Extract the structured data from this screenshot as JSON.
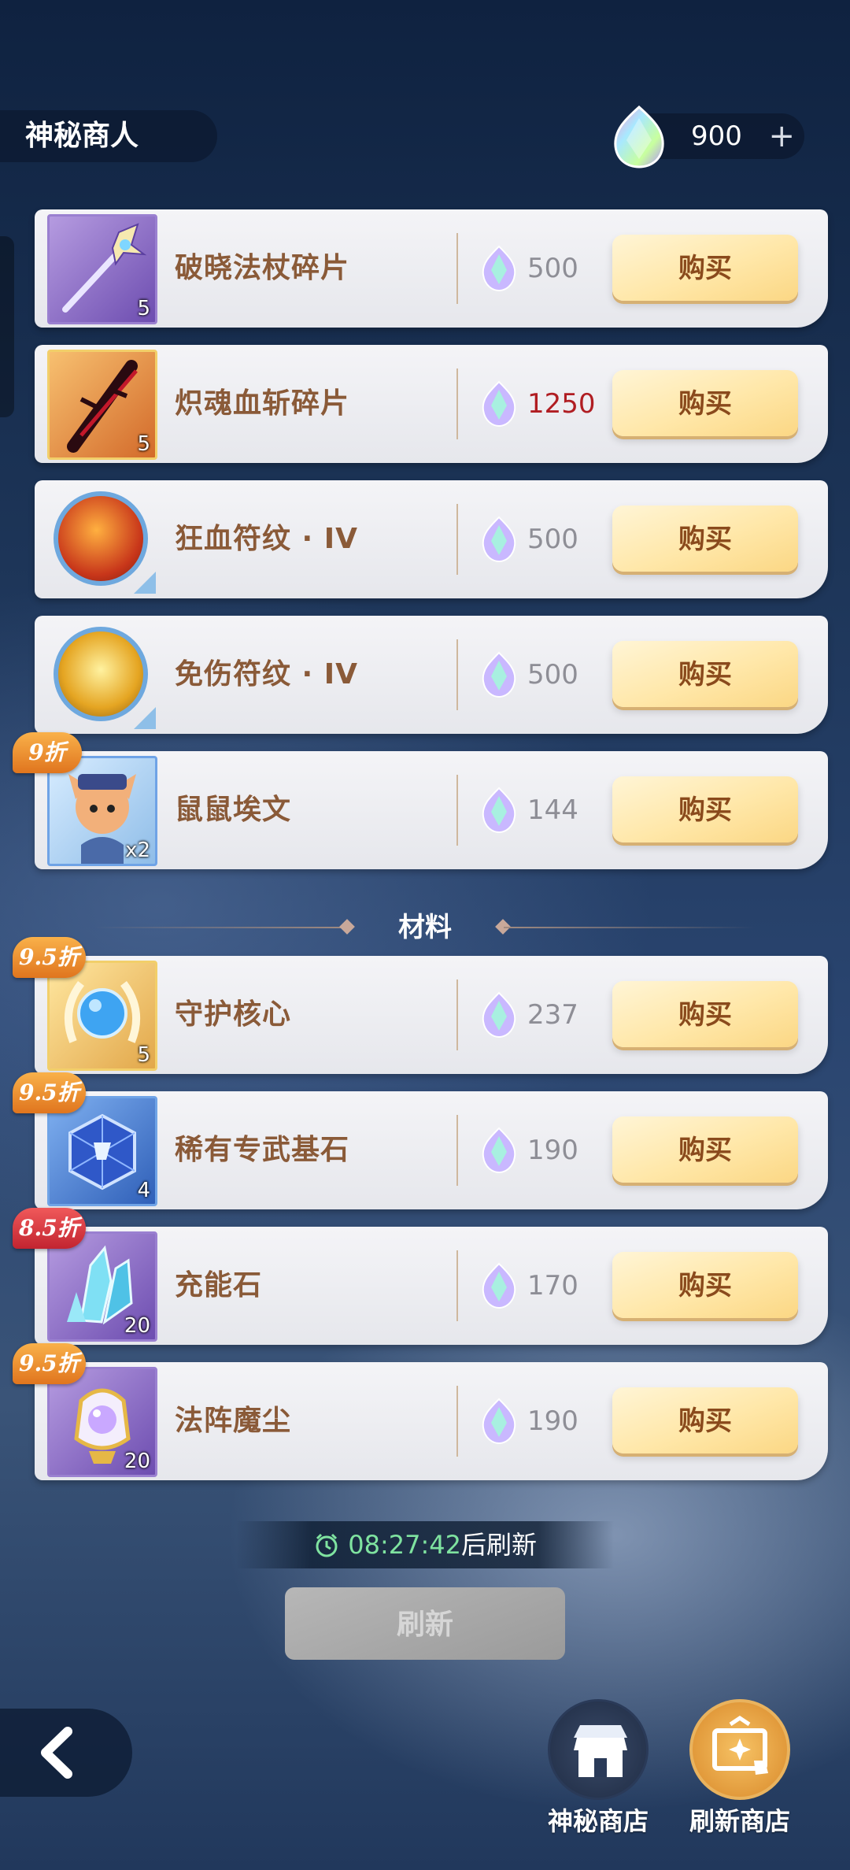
{
  "header": {
    "title": "神秘商人",
    "currency_amount": "900",
    "plus": "+"
  },
  "section_title": "材料",
  "items": [
    {
      "name": "破晓法杖碎片",
      "count": "5",
      "price": "500",
      "buy": "购买",
      "icon": "staff-fragment-icon"
    },
    {
      "name": "炽魂血斩碎片",
      "count": "5",
      "price": "1250",
      "buy": "购买",
      "icon": "blade-fragment-icon"
    },
    {
      "name": "狂血符纹 · IV",
      "price": "500",
      "buy": "购买",
      "icon": "fire-rune-icon"
    },
    {
      "name": "免伤符纹 · IV",
      "price": "500",
      "buy": "购买",
      "icon": "gold-rune-icon"
    },
    {
      "name": "鼠鼠埃文",
      "count": "x2",
      "price": "144",
      "buy": "购买",
      "badge": "9折",
      "icon": "hero-card-icon"
    },
    {
      "name": "守护核心",
      "count": "5",
      "price": "237",
      "buy": "购买",
      "badge": "9.5折",
      "icon": "guardian-core-icon"
    },
    {
      "name": "稀有专武基石",
      "count": "4",
      "price": "190",
      "buy": "购买",
      "badge": "9.5折",
      "icon": "cube-stone-icon"
    },
    {
      "name": "充能石",
      "count": "20",
      "price": "170",
      "buy": "购买",
      "badge": "8.5折",
      "icon": "crystal-icon"
    },
    {
      "name": "法阵魔尘",
      "count": "20",
      "price": "190",
      "buy": "购买",
      "badge": "9.5折",
      "icon": "magic-dust-jar-icon"
    }
  ],
  "timer": {
    "time": "08:27:42",
    "suffix": "后刷新"
  },
  "refresh_button": "刷新",
  "nav": {
    "shop_label": "神秘商店",
    "refresh_shop_label": "刷新商店"
  },
  "colors": {
    "price_expensive": "#b01d22",
    "buy_button": "#ffe7a8",
    "badge_orange": "#e0751e",
    "badge_red": "#c22430"
  }
}
